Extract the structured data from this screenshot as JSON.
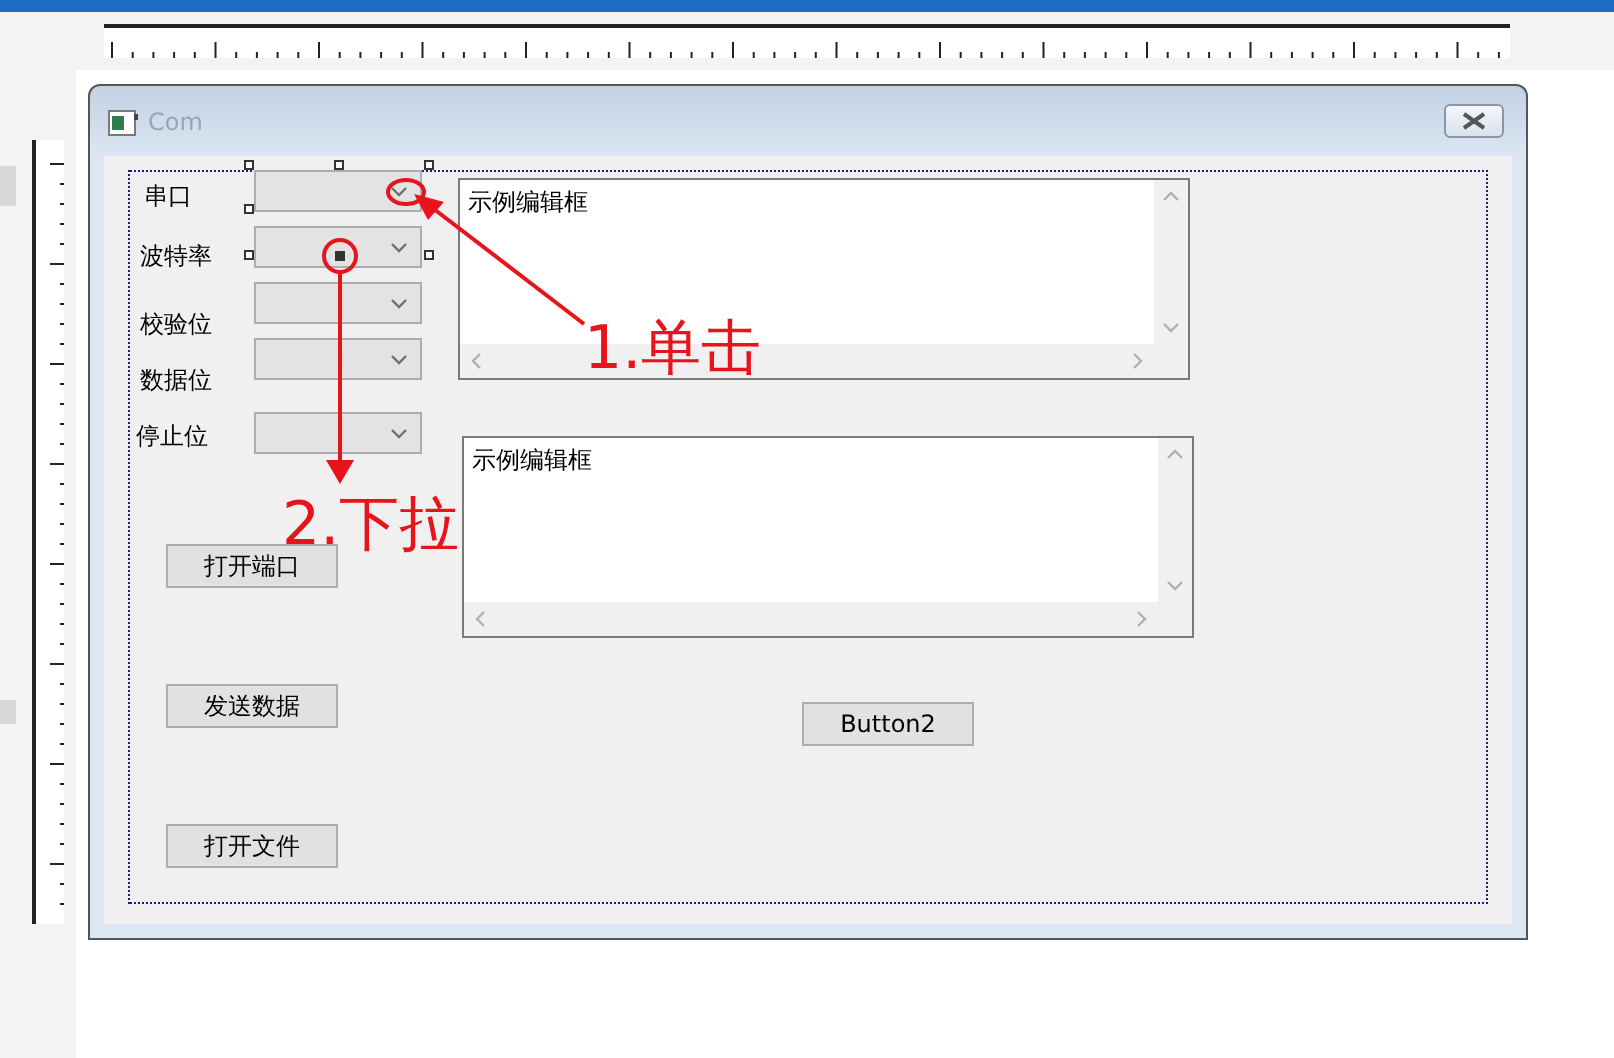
{
  "window": {
    "title": "Com"
  },
  "labels": [
    {
      "text": "串口"
    },
    {
      "text": "波特率"
    },
    {
      "text": "校验位"
    },
    {
      "text": "数据位"
    },
    {
      "text": "停止位"
    }
  ],
  "combos": [
    {
      "selected": true
    },
    {
      "selected": false
    },
    {
      "selected": false
    },
    {
      "selected": false
    },
    {
      "selected": false
    }
  ],
  "edits": [
    {
      "text": "示例编辑框"
    },
    {
      "text": "示例编辑框"
    }
  ],
  "buttons": [
    {
      "label": "打开端口"
    },
    {
      "label": "发送数据"
    },
    {
      "label": "打开文件"
    },
    {
      "label": "Button2"
    }
  ],
  "annotations": [
    {
      "text": "1.单击"
    },
    {
      "text": "2.下拉"
    }
  ]
}
